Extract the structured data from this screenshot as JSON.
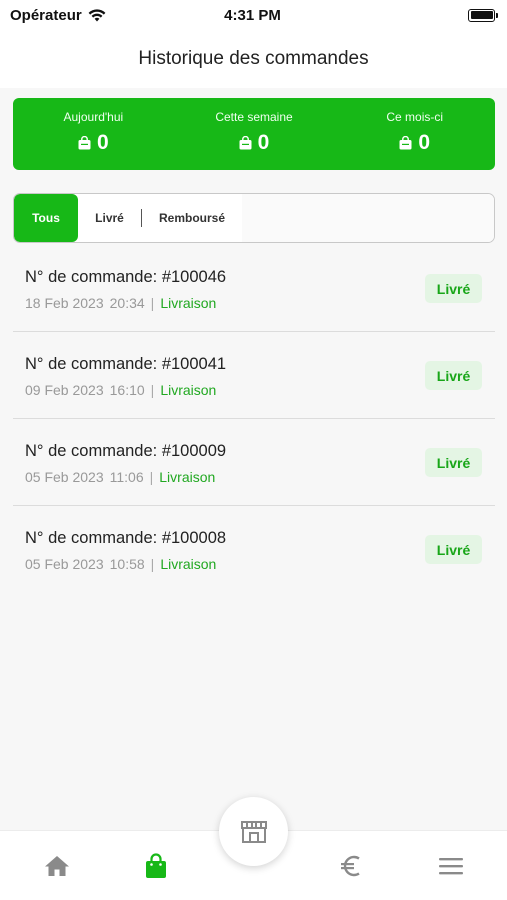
{
  "status_bar": {
    "carrier": "Opérateur",
    "time": "4:31 PM",
    "battery_level": 1.0
  },
  "header": {
    "title": "Historique des commandes"
  },
  "stats": [
    {
      "label": "Aujourd'hui",
      "value": "0",
      "icon": "shopping-bag-icon"
    },
    {
      "label": "Cette semaine",
      "value": "0",
      "icon": "shopping-bag-icon"
    },
    {
      "label": "Ce mois-ci",
      "value": "0",
      "icon": "shopping-bag-icon"
    }
  ],
  "tabs": [
    {
      "label": "Tous",
      "active": true
    },
    {
      "label": "Livré",
      "active": false
    },
    {
      "label": "Remboursé",
      "active": false
    }
  ],
  "orders": [
    {
      "title": "N° de commande: #100046",
      "date": "18 Feb 2023",
      "time": "20:34",
      "mode": "Livraison",
      "status": "Livré"
    },
    {
      "title": "N° de commande: #100041",
      "date": "09 Feb 2023",
      "time": "16:10",
      "mode": "Livraison",
      "status": "Livré"
    },
    {
      "title": "N° de commande: #100009",
      "date": "05 Feb 2023",
      "time": "11:06",
      "mode": "Livraison",
      "status": "Livré"
    },
    {
      "title": "N° de commande: #100008",
      "date": "05 Feb 2023",
      "time": "10:58",
      "mode": "Livraison",
      "status": "Livré"
    }
  ],
  "bottom_nav": {
    "items": [
      {
        "name": "home",
        "icon": "home-icon",
        "active": false
      },
      {
        "name": "orders",
        "icon": "shopping-bag-icon",
        "active": true
      },
      {
        "name": "store",
        "icon": "store-icon",
        "active": false
      },
      {
        "name": "payments",
        "icon": "euro-icon",
        "active": false
      },
      {
        "name": "menu",
        "icon": "menu-icon",
        "active": false
      }
    ]
  },
  "colors": {
    "accent": "#17b817",
    "badge_bg": "#e4f5e4",
    "inactive_icon": "#8a8a8a"
  }
}
